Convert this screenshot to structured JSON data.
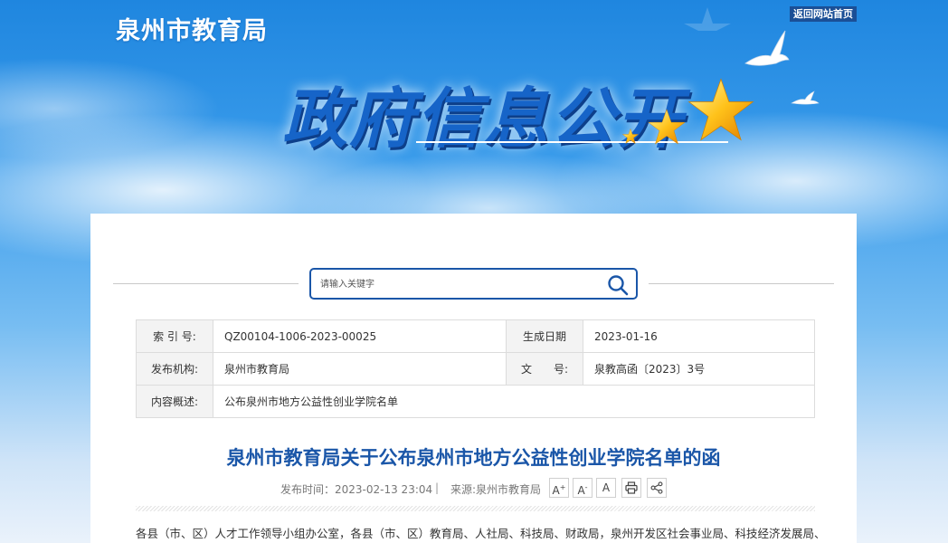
{
  "header": {
    "site_title": "泉州市教育局",
    "back_home": "返回网站首页",
    "banner_text": "政府信息公开"
  },
  "search": {
    "placeholder": "请输入关键字"
  },
  "info": {
    "index_label": "索 引 号:",
    "index_value": "QZ00104-1006-2023-00025",
    "date_label": "生成日期",
    "date_value": "2023-01-16",
    "publisher_label": "发布机构:",
    "publisher_value": "泉州市教育局",
    "doc_label": "文　　号:",
    "doc_value": "泉教高函〔2023〕3号",
    "summary_label": "内容概述:",
    "summary_value": "公布泉州市地方公益性创业学院名单"
  },
  "article": {
    "title": "泉州市教育局关于公布泉州市地方公益性创业学院名单的函",
    "publish_time": "发布时间：2023-02-13 23:04",
    "separator": "|",
    "source": "来源:泉州市教育局",
    "tools": {
      "font_large": "A",
      "font_small": "A",
      "font_normal": "A",
      "plus_mark": "+",
      "minus_mark": "-"
    },
    "body_first_line": "各县（市、区）人才工作领导小组办公室，各县（市、区）教育局、人社局、科技局、财政局，泉州开发区社会事业局、科技经济发展局、财政局，泉"
  },
  "colors": {
    "accent_blue": "#1a56a8",
    "banner_blue": "#1664c8",
    "back_home_bg": "#1a4f96"
  }
}
